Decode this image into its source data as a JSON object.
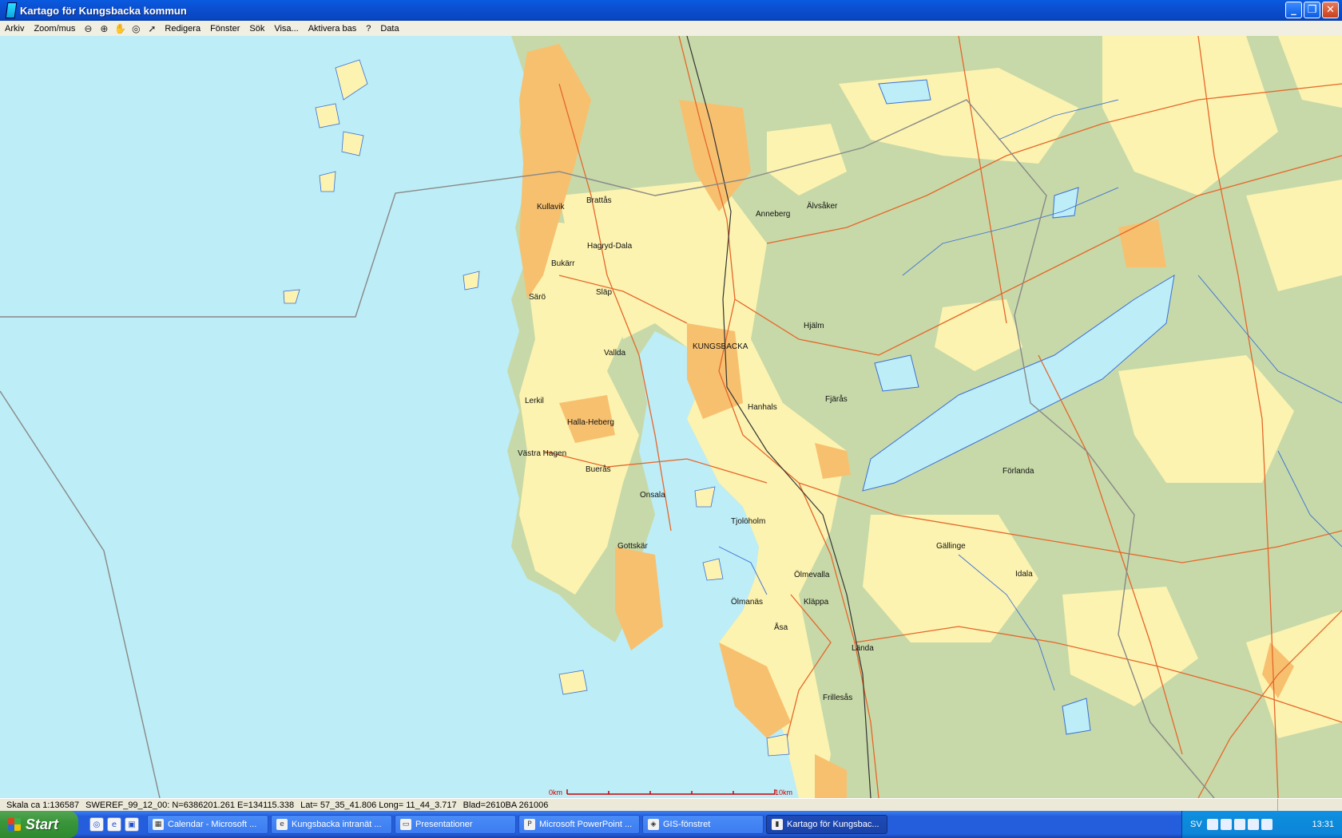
{
  "window": {
    "title": "Kartago för Kungsbacka kommun",
    "buttons": {
      "minimize": "_",
      "restore": "❐",
      "close": "✕"
    }
  },
  "menubar": {
    "items": [
      "Arkiv",
      "Zoom/mus",
      "Redigera",
      "Fönster",
      "Sök",
      "Visa...",
      "Aktivera bas",
      "?",
      "Data"
    ],
    "tools": [
      "zoom-out-icon",
      "zoom-in-icon",
      "pan-hand-icon",
      "full-extent-icon",
      "pointer-icon"
    ]
  },
  "map": {
    "places": [
      {
        "name": "Kullavik"
      },
      {
        "name": "Brattås"
      },
      {
        "name": "Anneberg"
      },
      {
        "name": "Älvsåker"
      },
      {
        "name": "Hagryd-Dala"
      },
      {
        "name": "Bukärr"
      },
      {
        "name": "Särö"
      },
      {
        "name": "Släp"
      },
      {
        "name": "Hjälm"
      },
      {
        "name": "KUNGSBACKA"
      },
      {
        "name": "Vallda"
      },
      {
        "name": "Lerkil"
      },
      {
        "name": "Hanhals"
      },
      {
        "name": "Fjärås"
      },
      {
        "name": "Halla-Heberg"
      },
      {
        "name": "Västra Hagen"
      },
      {
        "name": "Buerås"
      },
      {
        "name": "Förlanda"
      },
      {
        "name": "Onsala"
      },
      {
        "name": "Tjolöholm"
      },
      {
        "name": "Gottskär"
      },
      {
        "name": "Gällinge"
      },
      {
        "name": "Idala"
      },
      {
        "name": "Ölmevalla"
      },
      {
        "name": "Ölmanäs"
      },
      {
        "name": "Kläppa"
      },
      {
        "name": "Åsa"
      },
      {
        "name": "Lända"
      },
      {
        "name": "Frillesås"
      }
    ],
    "scale_start": "0km",
    "scale_end": "10km",
    "colors": {
      "water": "#BDEDF6",
      "forest": "#C7D9A8",
      "open_land": "#FCF3B0",
      "urban": "#F7C06F",
      "roads": "#E5662A",
      "streams": "#3A6FD8"
    }
  },
  "statusbar": {
    "scale": "Skala ca 1:136587",
    "coords": "SWEREF_99_12_00: N=6386201.261  E=134115.338",
    "latlong": "Lat= 57_35_41.806  Long= 11_44_3.717",
    "blad": "Blad=2610BA 261006"
  },
  "taskbar": {
    "start": "Start",
    "quicklaunch": [
      "outlook-icon",
      "ie-icon",
      "desktop-icon"
    ],
    "tasks": [
      {
        "label": "Calendar - Microsoft ...",
        "icon": "calendar-icon",
        "active": false
      },
      {
        "label": "Kungsbacka intranät ...",
        "icon": "ie-icon",
        "active": false
      },
      {
        "label": "Presentationer",
        "icon": "folder-icon",
        "active": false
      },
      {
        "label": "Microsoft PowerPoint ...",
        "icon": "powerpoint-icon",
        "active": false
      },
      {
        "label": "GIS-fönstret",
        "icon": "gis-icon",
        "active": false
      },
      {
        "label": "Kartago för Kungsbac...",
        "icon": "kartago-icon",
        "active": true
      }
    ],
    "tray": {
      "language": "SV",
      "clock": "13:31"
    }
  }
}
